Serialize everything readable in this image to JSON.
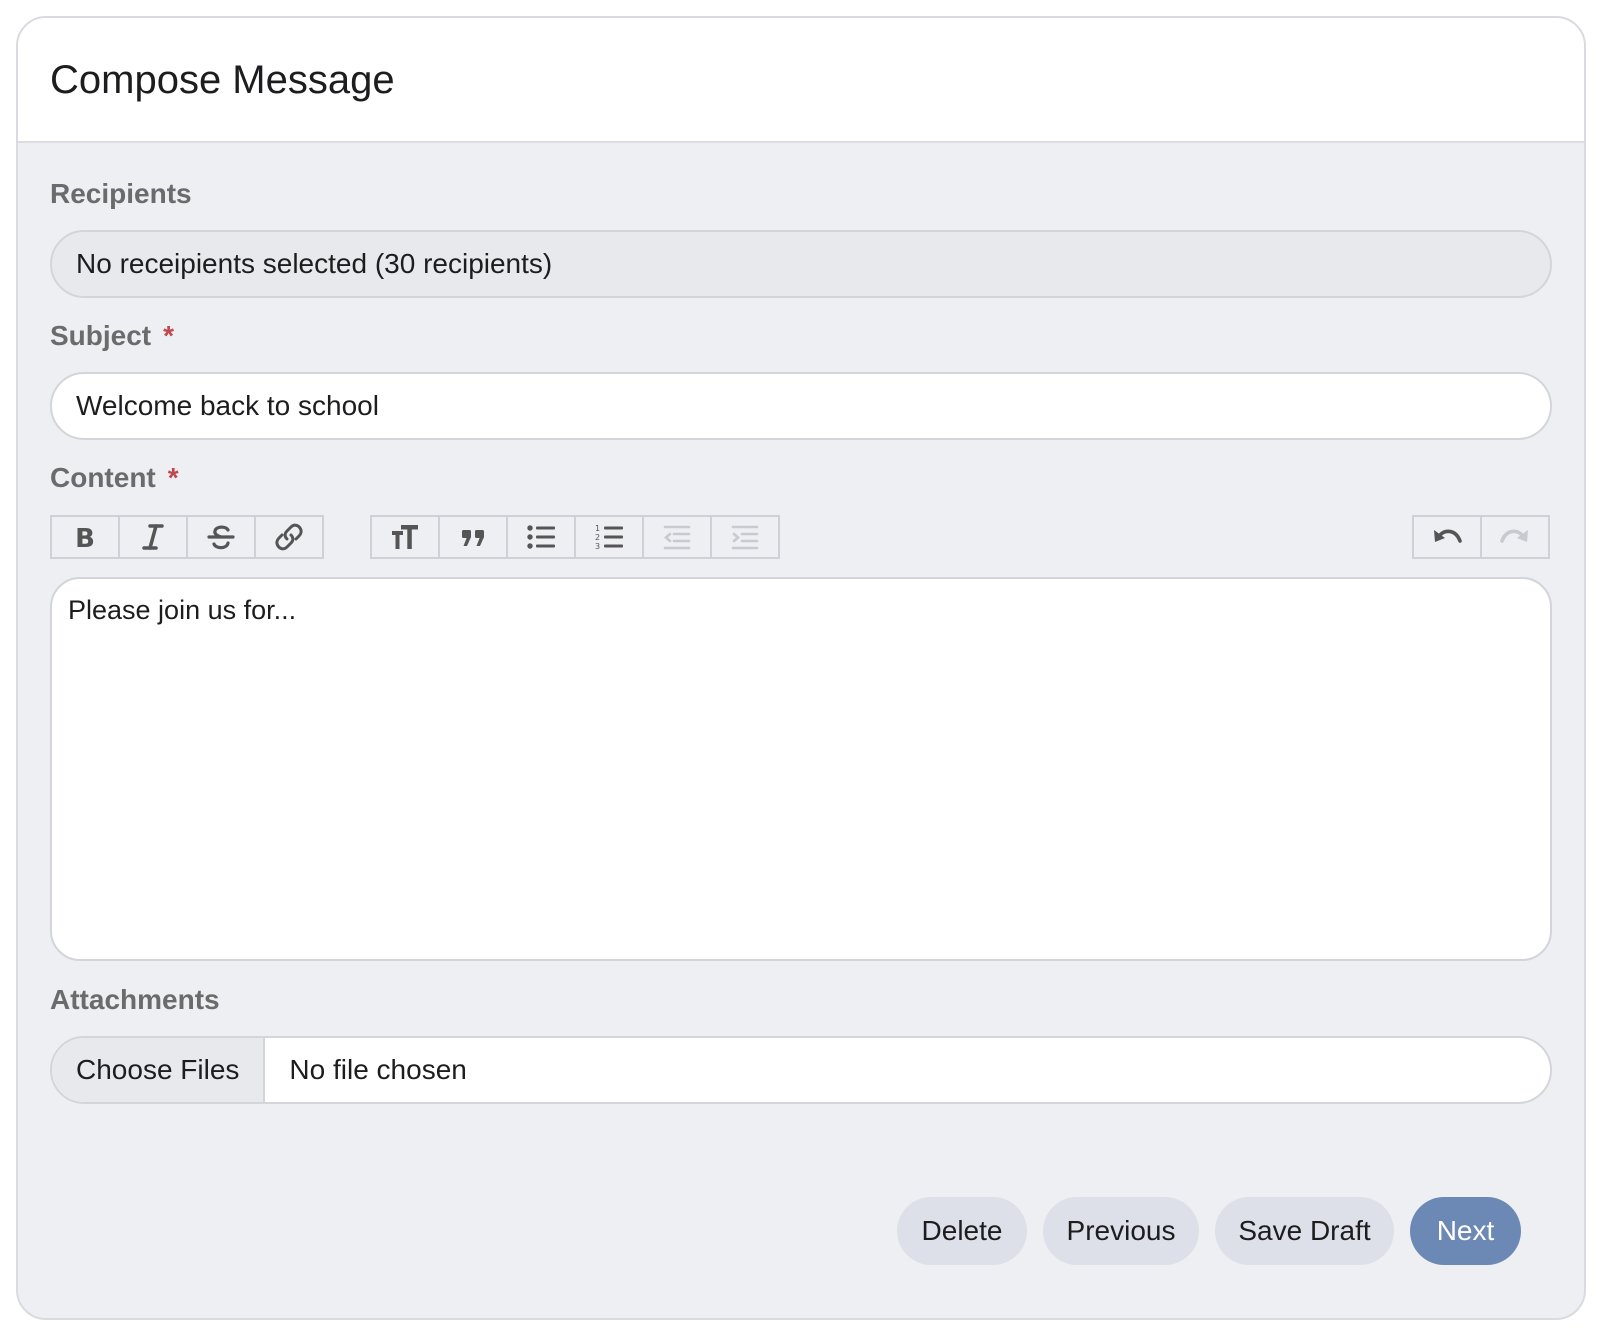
{
  "header": {
    "title": "Compose Message"
  },
  "recipients": {
    "label": "Recipients",
    "value": "No receipients selected (30 recipients)"
  },
  "subject": {
    "label": "Subject",
    "required_mark": "*",
    "value": "Welcome back to school"
  },
  "content": {
    "label": "Content",
    "required_mark": "*",
    "text": "Please join us for..."
  },
  "toolbar": {
    "format_group": [
      "bold-icon",
      "italic-icon",
      "strikethrough-icon",
      "link-icon"
    ],
    "block_group": [
      "heading-icon",
      "quote-icon",
      "bullet-list-icon",
      "numbered-list-icon",
      "outdent-icon",
      "indent-icon"
    ],
    "history_group": [
      "undo-icon",
      "redo-icon"
    ],
    "disabled": [
      "outdent-icon",
      "indent-icon",
      "redo-icon"
    ]
  },
  "attachments": {
    "label": "Attachments",
    "button_label": "Choose Files",
    "status": "No file chosen"
  },
  "actions": {
    "delete": "Delete",
    "previous": "Previous",
    "save_draft": "Save Draft",
    "next": "Next"
  },
  "colors": {
    "primary": "#6c88b4",
    "required": "#c0484d",
    "secondary_button": "#dde0e8"
  }
}
